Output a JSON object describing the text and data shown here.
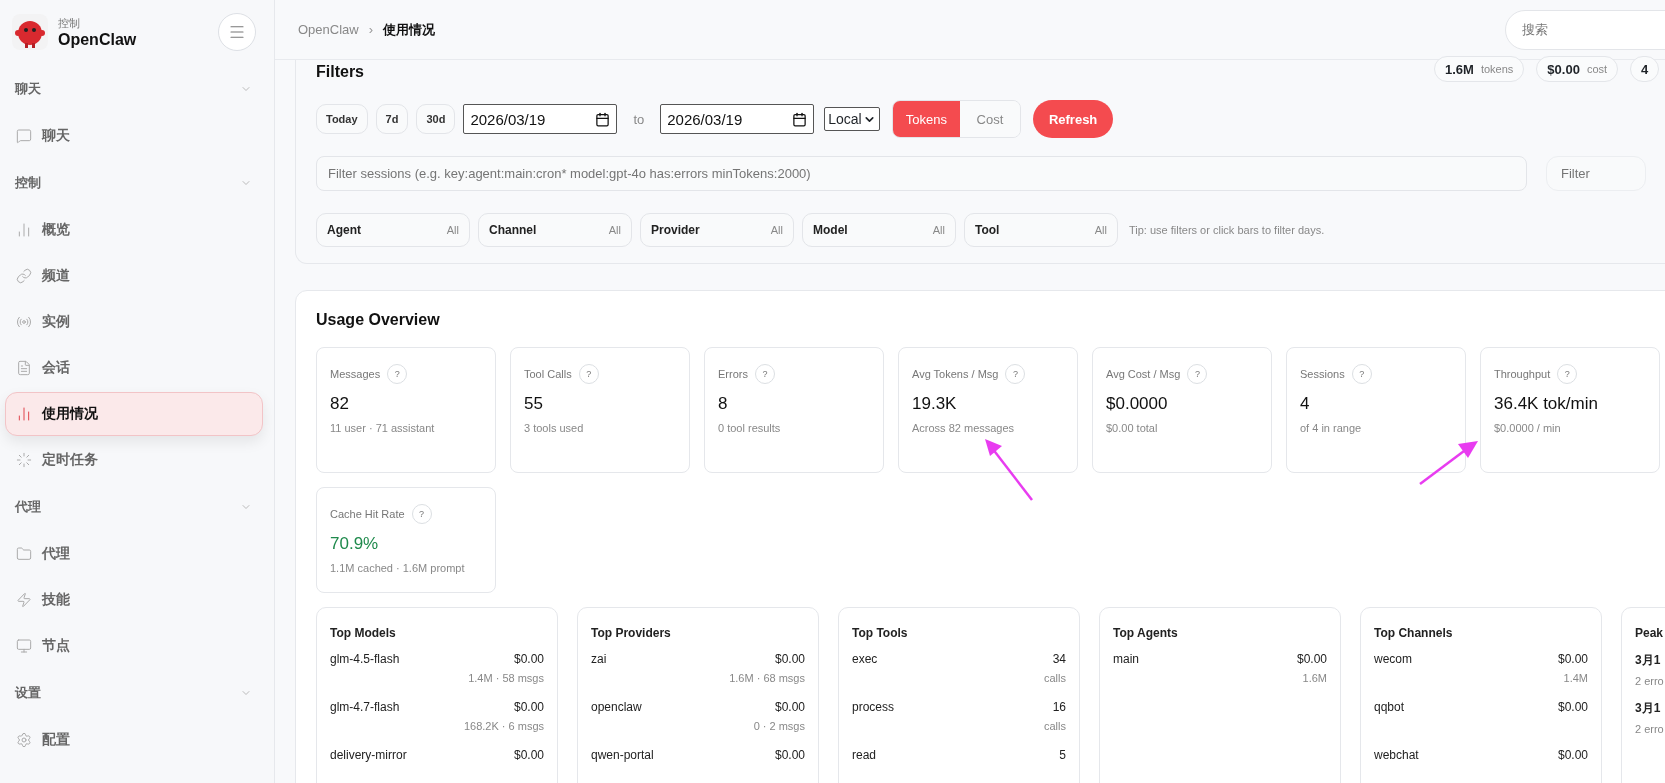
{
  "sidebar": {
    "brand": {
      "subtitle": "控制",
      "name": "OpenClaw"
    },
    "groups": [
      {
        "label": "聊天",
        "items": [
          {
            "label": "聊天",
            "selected": false
          }
        ]
      },
      {
        "label": "控制",
        "items": [
          {
            "label": "概览",
            "selected": false
          },
          {
            "label": "频道",
            "selected": false
          },
          {
            "label": "实例",
            "selected": false
          },
          {
            "label": "会话",
            "selected": false
          },
          {
            "label": "使用情况",
            "selected": true
          },
          {
            "label": "定时任务",
            "selected": false
          }
        ]
      },
      {
        "label": "代理",
        "items": [
          {
            "label": "代理",
            "selected": false
          },
          {
            "label": "技能",
            "selected": false
          },
          {
            "label": "节点",
            "selected": false
          }
        ]
      },
      {
        "label": "设置",
        "items": [
          {
            "label": "配置",
            "selected": false
          }
        ]
      }
    ]
  },
  "topbar": {
    "breadcrumb": [
      "OpenClaw",
      "使用情况"
    ],
    "separator": "›",
    "search": {
      "placeholder": "搜索"
    }
  },
  "filters": {
    "title": "Filters",
    "stats": [
      {
        "value": "1.6M",
        "unit": "tokens"
      },
      {
        "value": "$0.00",
        "unit": "cost"
      },
      {
        "value": "4"
      }
    ],
    "ranges": [
      "Today",
      "7d",
      "30d"
    ],
    "from": "2026/03/19",
    "to_label": "to",
    "to": "2026/03/19",
    "timezone": "Local",
    "modes": [
      {
        "label": "Tokens",
        "selected": true
      },
      {
        "label": "Cost",
        "selected": false
      }
    ],
    "refresh": "Refresh",
    "query": {
      "placeholder": "Filter sessions (e.g. key:agent:main:cron* model:gpt-4o has:errors minTokens:2000)"
    },
    "side_field": {
      "placeholder": "Filter"
    },
    "dropdowns": [
      {
        "label": "Agent",
        "value": "All"
      },
      {
        "label": "Channel",
        "value": "All"
      },
      {
        "label": "Provider",
        "value": "All"
      },
      {
        "label": "Model",
        "value": "All"
      },
      {
        "label": "Tool",
        "value": "All"
      }
    ],
    "tip": "Tip: use filters or click bars to filter days."
  },
  "overview": {
    "title": "Usage Overview",
    "cards": [
      {
        "label": "Messages",
        "help": "?",
        "value": "82",
        "sub": "11 user · 71 assistant",
        "positive": false
      },
      {
        "label": "Tool Calls",
        "help": "?",
        "value": "55",
        "sub": "3 tools used",
        "positive": false
      },
      {
        "label": "Errors",
        "help": "?",
        "value": "8",
        "sub": "0 tool results",
        "positive": false
      },
      {
        "label": "Avg Tokens / Msg",
        "help": "?",
        "value": "19.3K",
        "sub": "Across 82 messages",
        "positive": false
      },
      {
        "label": "Avg Cost / Msg",
        "help": "?",
        "value": "$0.0000",
        "sub": "$0.00 total",
        "positive": false
      },
      {
        "label": "Sessions",
        "help": "?",
        "value": "4",
        "sub": "of 4 in range",
        "positive": false
      },
      {
        "label": "Throughput",
        "help": "?",
        "value": "36.4K tok/min",
        "sub": "$0.0000 / min",
        "positive": false
      },
      {
        "label": "Cache Hit Rate",
        "help": "?",
        "value": "70.9%",
        "sub": "1.1M cached · 1.6M prompt",
        "positive": true
      }
    ],
    "tables": [
      {
        "title": "Top Models",
        "rows": [
          {
            "name": "glm-4.5-flash",
            "value": "$0.00",
            "sub": "1.4M · 58 msgs"
          },
          {
            "name": "glm-4.7-flash",
            "value": "$0.00",
            "sub": "168.2K · 6 msgs"
          },
          {
            "name": "delivery-mirror",
            "value": "$0.00"
          }
        ]
      },
      {
        "title": "Top Providers",
        "rows": [
          {
            "name": "zai",
            "value": "$0.00",
            "sub": "1.6M · 68 msgs"
          },
          {
            "name": "openclaw",
            "value": "$0.00",
            "sub": "0 · 2 msgs"
          },
          {
            "name": "qwen-portal",
            "value": "$0.00"
          }
        ]
      },
      {
        "title": "Top Tools",
        "rows": [
          {
            "name": "exec",
            "value": "34",
            "sub": "calls"
          },
          {
            "name": "process",
            "value": "16",
            "sub": "calls"
          },
          {
            "name": "read",
            "value": "5"
          }
        ]
      },
      {
        "title": "Top Agents",
        "rows": [
          {
            "name": "main",
            "value": "$0.00",
            "sub": "1.6M"
          }
        ]
      },
      {
        "title": "Top Channels",
        "rows": [
          {
            "name": "wecom",
            "value": "$0.00",
            "sub": "1.4M"
          },
          {
            "name": "qqbot",
            "value": "$0.00"
          },
          {
            "name": "webchat",
            "value": "$0.00"
          }
        ]
      },
      {
        "title": "Peak",
        "rows": [
          {
            "name": "3月1",
            "sub": "2 erro"
          },
          {
            "name": "3月1",
            "sub": "2 erro"
          }
        ]
      }
    ]
  }
}
